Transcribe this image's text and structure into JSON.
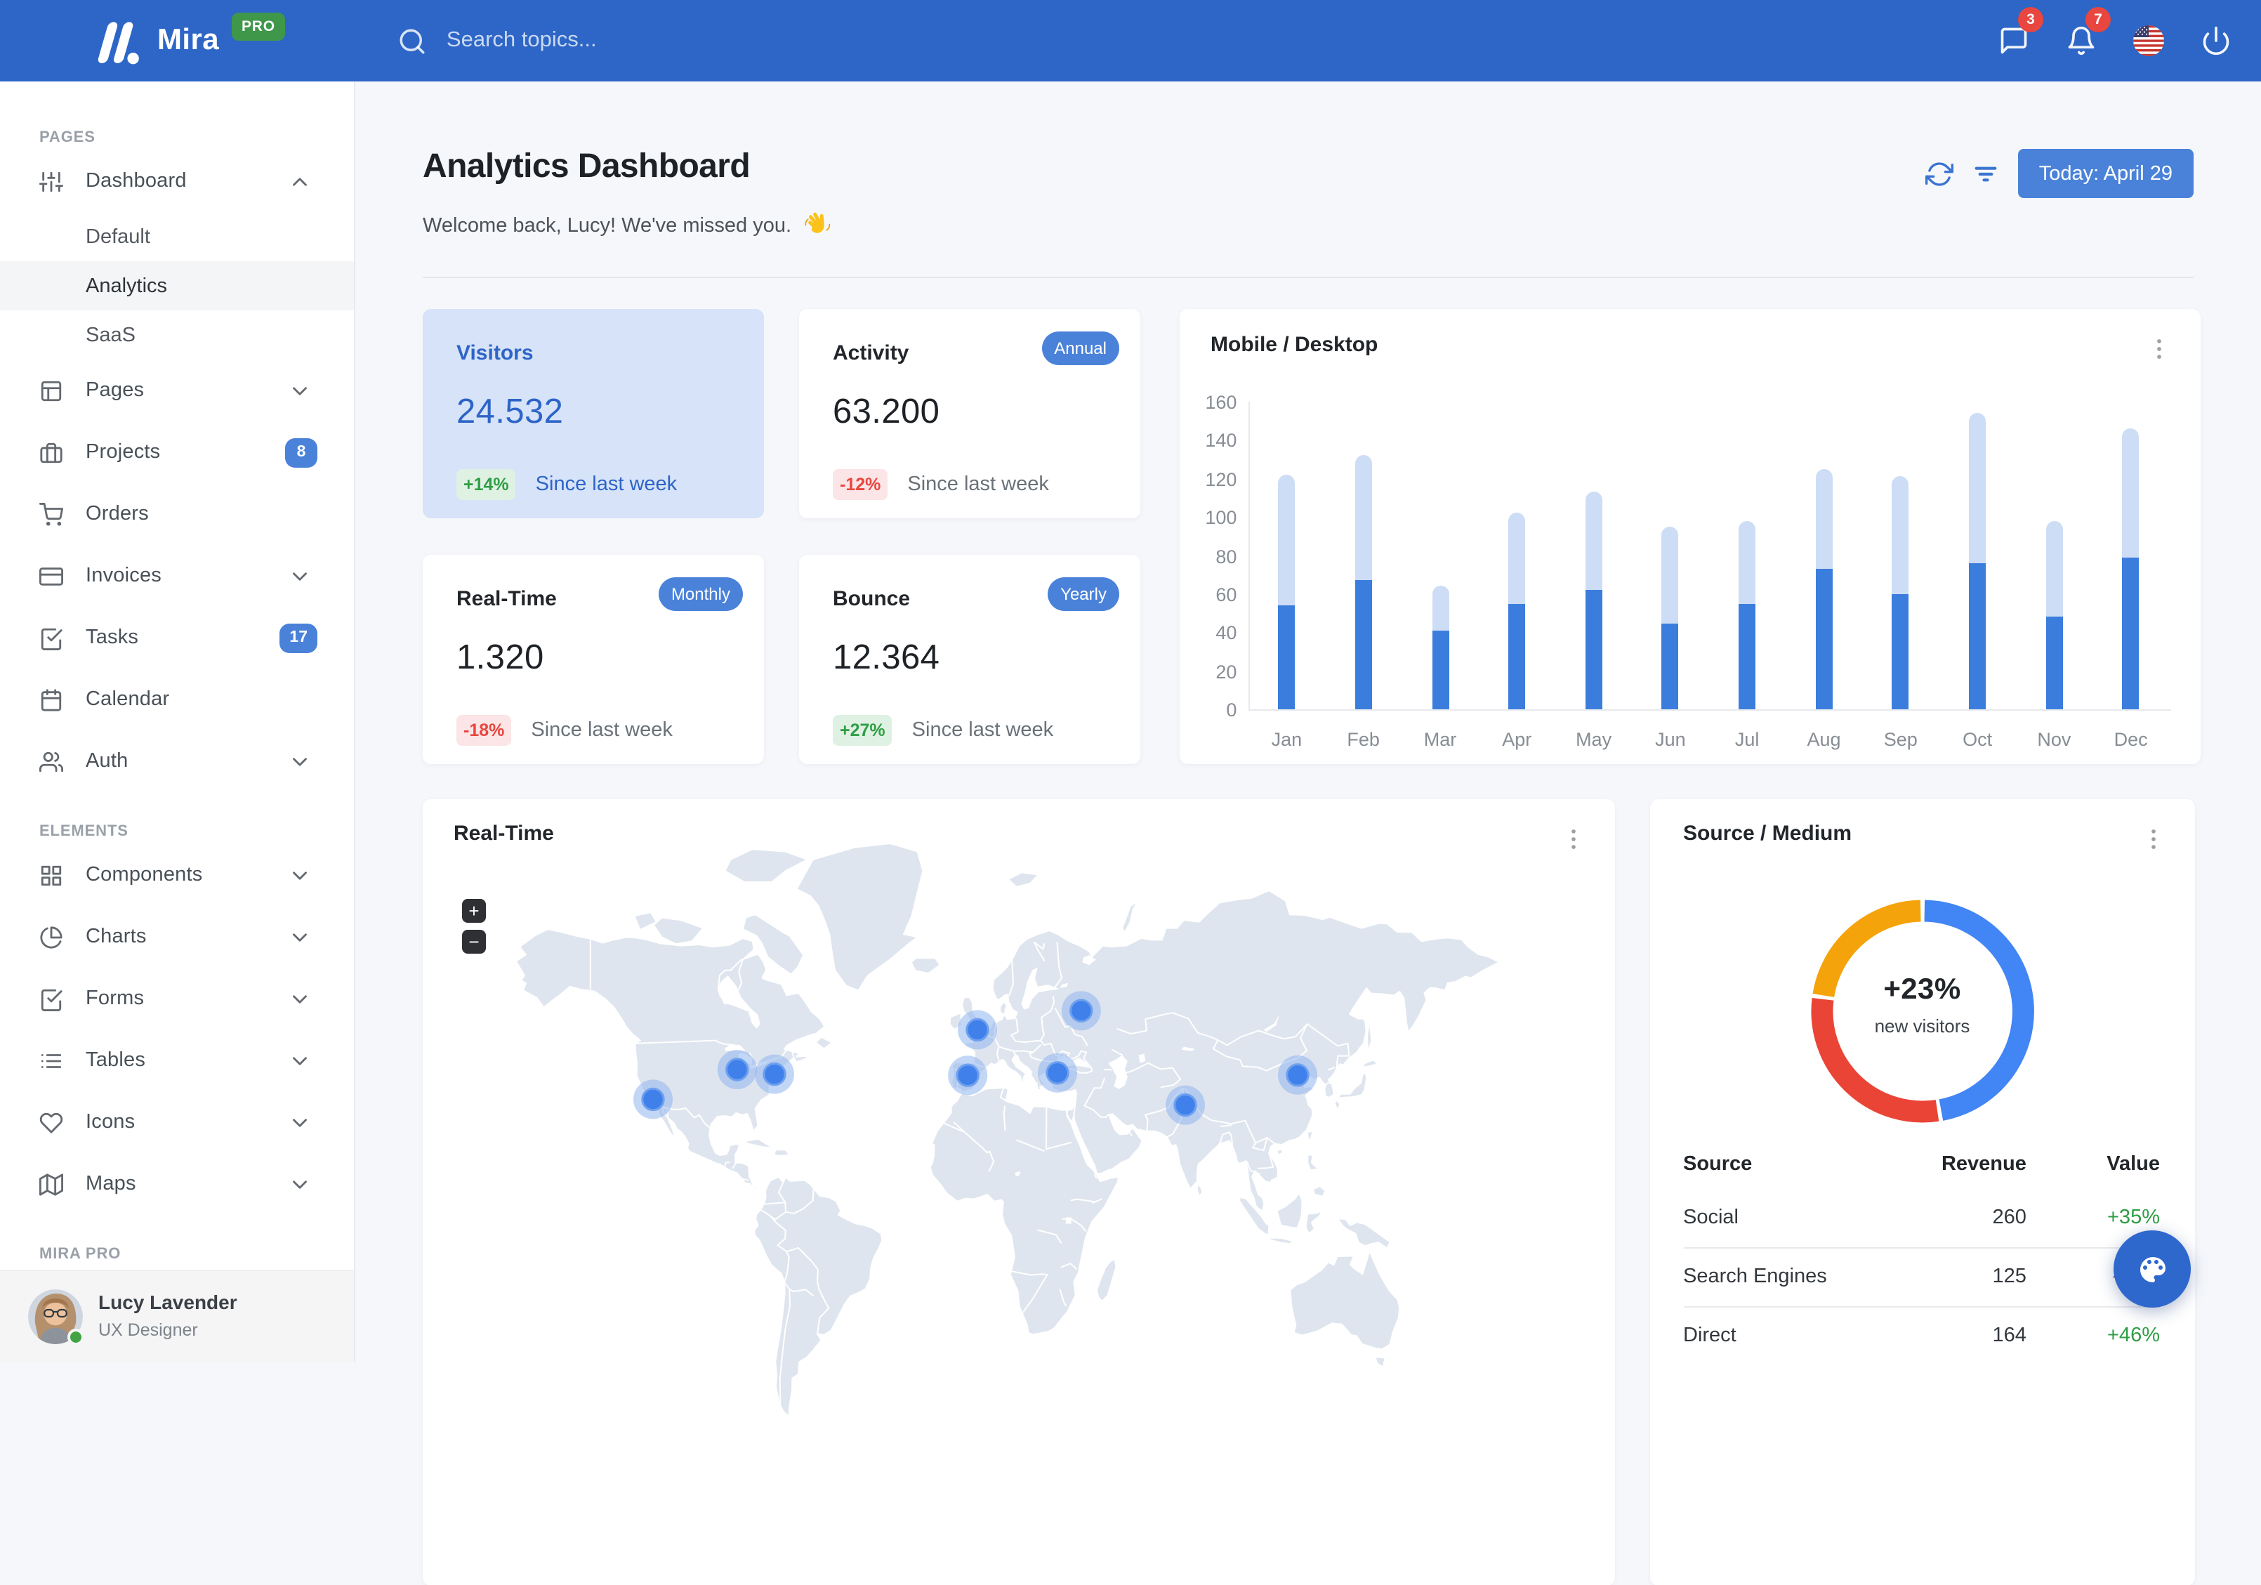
{
  "navbar": {
    "brand": "Mira",
    "brand_badge": "PRO",
    "search_placeholder": "Search topics...",
    "messages_count": "3",
    "notifications_count": "7"
  },
  "sidebar": {
    "sections": [
      {
        "label": "PAGES",
        "items": [
          {
            "icon": "sliders",
            "label": "Dashboard",
            "chevron": "up",
            "children": [
              {
                "label": "Default"
              },
              {
                "label": "Analytics",
                "active": true
              },
              {
                "label": "SaaS"
              }
            ]
          },
          {
            "icon": "layout",
            "label": "Pages",
            "chevron": "down"
          },
          {
            "icon": "briefcase",
            "label": "Projects",
            "badge": "8"
          },
          {
            "icon": "shopping-cart",
            "label": "Orders"
          },
          {
            "icon": "credit-card",
            "label": "Invoices",
            "chevron": "down"
          },
          {
            "icon": "check-square",
            "label": "Tasks",
            "badge": "17"
          },
          {
            "icon": "calendar",
            "label": "Calendar"
          },
          {
            "icon": "users",
            "label": "Auth",
            "chevron": "down"
          }
        ]
      },
      {
        "label": "ELEMENTS",
        "items": [
          {
            "icon": "grid",
            "label": "Components",
            "chevron": "down"
          },
          {
            "icon": "pie-chart",
            "label": "Charts",
            "chevron": "down"
          },
          {
            "icon": "check-square",
            "label": "Forms",
            "chevron": "down"
          },
          {
            "icon": "list",
            "label": "Tables",
            "chevron": "down"
          },
          {
            "icon": "heart",
            "label": "Icons",
            "chevron": "down"
          },
          {
            "icon": "map",
            "label": "Maps",
            "chevron": "down"
          }
        ]
      },
      {
        "label": "MIRA PRO",
        "items": []
      }
    ],
    "user": {
      "name": "Lucy Lavender",
      "role": "UX Designer"
    }
  },
  "header": {
    "title": "Analytics Dashboard",
    "subtitle": "Welcome back, Lucy! We've missed you.",
    "date_button": "Today: April 29"
  },
  "stats": [
    {
      "title": "Visitors",
      "value": "24.532",
      "delta": "+14%",
      "delta_dir": "up",
      "note": "Since last week",
      "highlight": true
    },
    {
      "title": "Activity",
      "pill": "Annual",
      "value": "63.200",
      "delta": "-12%",
      "delta_dir": "down",
      "note": "Since last week"
    },
    {
      "title": "Real-Time",
      "pill": "Monthly",
      "value": "1.320",
      "delta": "-18%",
      "delta_dir": "down",
      "note": "Since last week"
    },
    {
      "title": "Bounce",
      "pill": "Yearly",
      "value": "12.364",
      "delta": "+27%",
      "delta_dir": "up",
      "note": "Since last week"
    }
  ],
  "chart_data": [
    {
      "type": "bar",
      "stacked": true,
      "title": "Mobile / Desktop",
      "categories": [
        "Jan",
        "Feb",
        "Mar",
        "Apr",
        "May",
        "Jun",
        "Jul",
        "Aug",
        "Sep",
        "Oct",
        "Nov",
        "Dec"
      ],
      "series": [
        {
          "name": "Mobile",
          "values": [
            54,
            67,
            41,
            55,
            62,
            45,
            55,
            73,
            60,
            76,
            48,
            79
          ]
        },
        {
          "name": "Desktop",
          "values": [
            68,
            65,
            23,
            47,
            51,
            50,
            43,
            52,
            61,
            78,
            50,
            67
          ]
        }
      ],
      "ylim": [
        0,
        160
      ],
      "ytick_step": 20,
      "grid": false,
      "legend": "none"
    },
    {
      "type": "pie",
      "title": "Source / Medium",
      "donut": true,
      "center_value": "+23%",
      "center_label": "new visitors",
      "values": [
        260,
        164,
        125
      ],
      "colors": [
        "#4285f4",
        "#ea4436",
        "#f5a30b"
      ],
      "legend": "none"
    }
  ],
  "map_card": {
    "title": "Real-Time",
    "zoom_in": "+",
    "zoom_out": "−",
    "marker_count": 9
  },
  "source_card": {
    "title": "Source / Medium",
    "columns": [
      "Source",
      "Revenue",
      "Value"
    ],
    "rows": [
      {
        "source": "Social",
        "revenue": "260",
        "value": "+35%",
        "dir": "up"
      },
      {
        "source": "Search Engines",
        "revenue": "125",
        "value": "-12%",
        "dir": "down"
      },
      {
        "source": "Direct",
        "revenue": "164",
        "value": "+46%",
        "dir": "up"
      }
    ]
  },
  "colors": {
    "navbar": "#2d66c6",
    "primary": "#4a82d9",
    "bar_dark": "#3b7ddd",
    "bar_light": "#cdddf5",
    "success": "#3da853",
    "danger": "#e8463f",
    "badge_up_bg": "#dff1e3",
    "badge_down_bg": "#fbe5e6",
    "visitors_bg": "#d7e3f8",
    "visitors_fg": "#2d64c8",
    "donut_blue": "#4285f4",
    "donut_red": "#ea4436",
    "donut_orange": "#f5a30b",
    "pro_badge": "#3f9749"
  }
}
